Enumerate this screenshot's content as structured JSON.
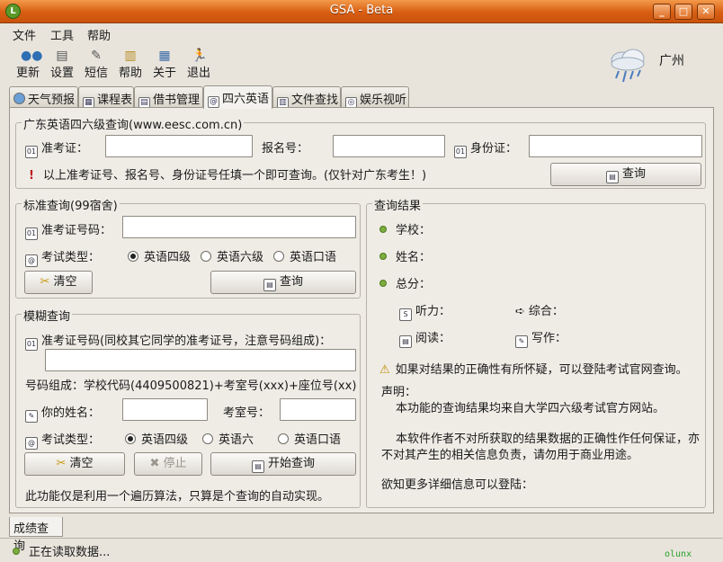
{
  "window": {
    "title": "GSA - Beta",
    "icon_letter": "L",
    "btn_min": "_",
    "btn_max": "□",
    "btn_close": "✕"
  },
  "menu": [
    "文件",
    "工具",
    "帮助"
  ],
  "toolbar": [
    {
      "label": "更新",
      "icon": "update-icon"
    },
    {
      "label": "设置",
      "icon": "settings-icon"
    },
    {
      "label": "短信",
      "icon": "sms-icon"
    },
    {
      "label": "帮助",
      "icon": "help-icon"
    },
    {
      "label": "关于",
      "icon": "about-icon"
    },
    {
      "label": "退出",
      "icon": "exit-icon"
    }
  ],
  "weather": {
    "city": "广州",
    "icon": "rain-cloud-icon"
  },
  "tabs": [
    {
      "label": "天气预报",
      "icon": "globe-icon"
    },
    {
      "label": "课程表",
      "icon": "table-icon"
    },
    {
      "label": "借书管理",
      "icon": "book-icon"
    },
    {
      "label": "四六英语",
      "icon": "english-icon",
      "active": true
    },
    {
      "label": "文件查找",
      "icon": "file-search-icon"
    },
    {
      "label": "娱乐视听",
      "icon": "media-icon"
    }
  ],
  "gd": {
    "title": "广东英语四六级查询(www.eesc.com.cn)",
    "label_ticket": "准考证：",
    "label_reg": "报名号：",
    "label_id": "身份证：",
    "ticket": "",
    "reg": "",
    "id": "",
    "note": "以上准考证号、报名号、身份证号任填一个即可查询。(仅针对广东考生！)",
    "query_btn": "查询"
  },
  "std": {
    "title": "标准查询(99宿舍)",
    "label_ticket": "准考证号码：",
    "ticket": "",
    "label_type": "考试类型：",
    "opt1": "英语四级",
    "opt2": "英语六级",
    "opt3": "英语口语",
    "clear_btn": "清空",
    "query_btn": "查询"
  },
  "fuzzy": {
    "title": "模糊查询",
    "label_ticket": "准考证号码(同校其它同学的准考证号，注意号码组成)：",
    "ticket": "",
    "composition": "号码组成：学校代码(4409500821)+考室号(xxx)+座位号(xx)",
    "label_name": "你的姓名：",
    "name": "",
    "label_room": "考室号：",
    "room": "",
    "label_type": "考试类型：",
    "opt1": "英语四级",
    "opt2": "英语六",
    "opt3": "英语口语",
    "clear_btn": "清空",
    "stop_btn": "停止",
    "start_btn": "开始查询",
    "footnote": "此功能仅是利用一个遍历算法，只算是个查询的自动实现。"
  },
  "result": {
    "title": "查询结果",
    "school": "学校：",
    "name": "姓名：",
    "total": "总分：",
    "listening": "听力：",
    "comprehensive": "综合：",
    "reading": "阅读：",
    "writing": "写作：",
    "warning": "如果对结果的正确性有所怀疑，可以登陆考试官网查询。",
    "decl_title": "声明：",
    "decl1": "本功能的查询结果均来自大学四六级考试官方网站。",
    "decl2a": "本软件作者不对所获取的结果数据的正确性作任何保证，亦",
    "decl2b": "不对其产生的相关信息负责，请勿用于商业用途。",
    "more": "欲知更多详细信息可以登陆："
  },
  "bottom_tab": "成绩查询",
  "status": {
    "text": "正在读取数据...",
    "watermark": "olunx"
  },
  "colors": {
    "titlebar": "#d75e12",
    "status_dot": "#7cad3e",
    "watermark": "#2aa02a"
  }
}
